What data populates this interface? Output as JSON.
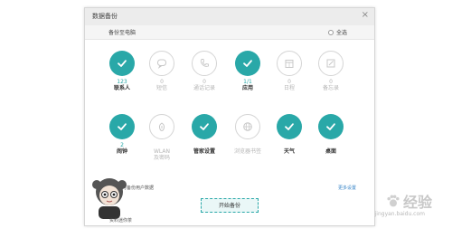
{
  "dialog": {
    "title": "数据备份",
    "close": "×"
  },
  "subbar": {
    "title": "备份至电脑",
    "select_all": "全选"
  },
  "items": [
    {
      "count": "123",
      "label": "联系人",
      "selected": true,
      "icon": "check-icon"
    },
    {
      "count": "0",
      "label": "短信",
      "selected": false,
      "icon": "message-icon"
    },
    {
      "count": "0",
      "label": "通话记录",
      "selected": false,
      "icon": "phone-icon"
    },
    {
      "count": "1/1",
      "label": "应用",
      "selected": true,
      "icon": "check-icon"
    },
    {
      "count": "0",
      "label": "日程",
      "selected": false,
      "icon": "calendar-icon"
    },
    {
      "count": "0",
      "label": "备忘录",
      "selected": false,
      "icon": "note-icon"
    },
    {
      "count": "2",
      "label": "闹钟",
      "selected": true,
      "icon": "check-icon"
    },
    {
      "count": "",
      "label": "WLAN\n及密码",
      "selected": false,
      "icon": "wifi-icon"
    },
    {
      "count": "",
      "label": "管家设置",
      "selected": true,
      "icon": "check-icon"
    },
    {
      "count": "",
      "label": "浏览器书签",
      "selected": false,
      "icon": "globe-icon"
    },
    {
      "count": "",
      "label": "天气",
      "selected": true,
      "icon": "check-icon"
    },
    {
      "count": "",
      "label": "桌面",
      "selected": true,
      "icon": "check-icon"
    }
  ],
  "footer": {
    "check_label": "同时备份用户数据",
    "more_settings": "更多设置",
    "start_button": "开始备份"
  },
  "mascot_text": "资料迷你茶",
  "watermark": {
    "text": "经验",
    "sub": "jingyan.baidu.com"
  },
  "colors": {
    "accent": "#29a8a8",
    "link": "#3a86c8"
  }
}
